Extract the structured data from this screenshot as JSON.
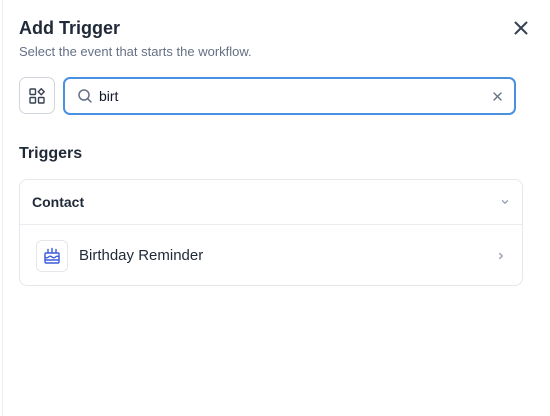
{
  "dialog": {
    "title": "Add Trigger",
    "subtitle": "Select the event that starts the workflow."
  },
  "search": {
    "value": "birt",
    "placeholder": ""
  },
  "section": {
    "title": "Triggers"
  },
  "groups": [
    {
      "label": "Contact",
      "items": [
        {
          "label": "Birthday Reminder",
          "icon": "birthday-cake-icon"
        }
      ]
    }
  ],
  "colors": {
    "accent": "#4a90e2",
    "icon_blue": "#3b5bdb"
  }
}
